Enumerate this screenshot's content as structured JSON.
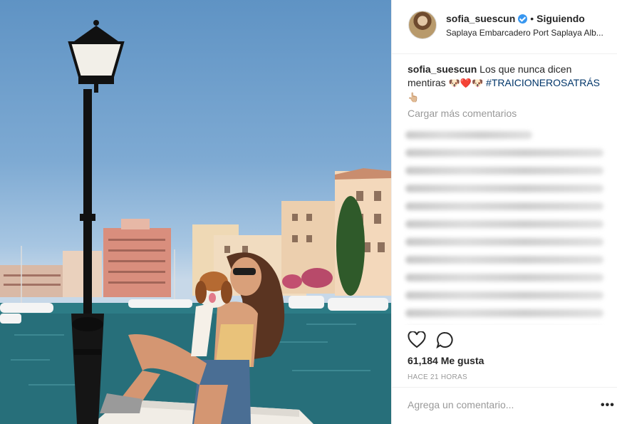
{
  "post": {
    "username": "sofia_suescun",
    "follow_status": "Siguiendo",
    "separator": "•",
    "location": "Saplaya Embarcadero Port Saplaya Alb...",
    "caption_user": "sofia_suescun",
    "caption_text": "Los que nunca dicen mentiras",
    "caption_emojis": "🐶❤️🐶",
    "hashtag": "#TRAICIONEROSATRÁS",
    "caption_end_emoji": "👆🏼",
    "load_more": "Cargar más comentarios",
    "likes": "61,184 Me gusta",
    "timestamp": "HACE 21 HORAS",
    "comment_placeholder": "Agrega un comentario...",
    "more_label": "•••"
  },
  "icons": {
    "like": "heart-icon",
    "comment": "comment-bubble-icon",
    "verified": "verified-badge-icon",
    "more": "more-options-icon"
  },
  "colors": {
    "verified": "#3897f0",
    "hashtag": "#003569",
    "muted": "#999999",
    "text": "#262626"
  }
}
